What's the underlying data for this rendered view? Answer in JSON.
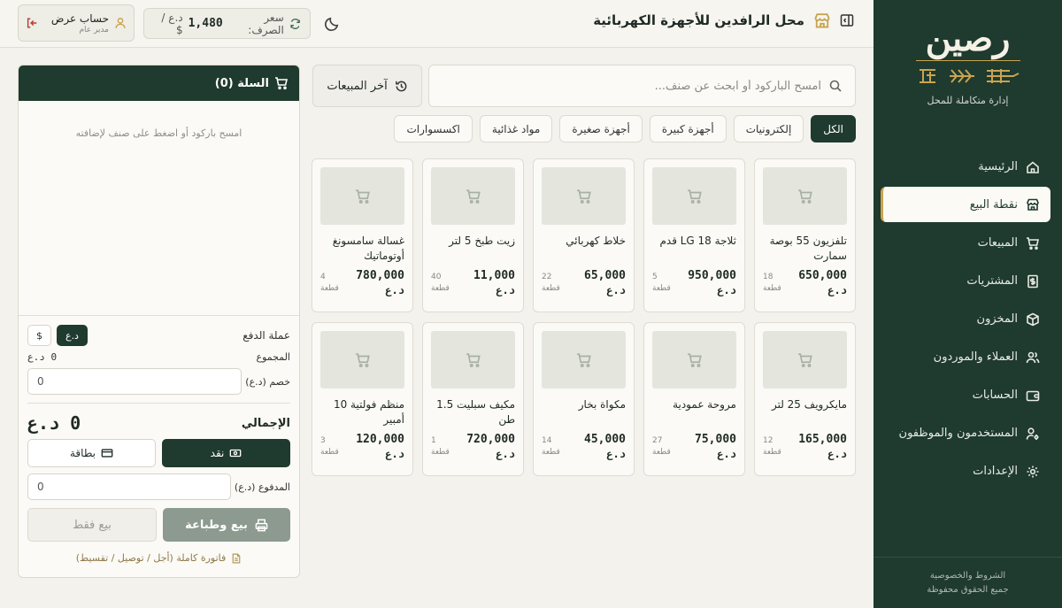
{
  "sidebar": {
    "logo_text": "رصين",
    "tagline": "إدارة متكاملة للمحل",
    "items": [
      {
        "label": "الرئيسية",
        "icon": "home-icon"
      },
      {
        "label": "نقطة البيع",
        "icon": "store-icon"
      },
      {
        "label": "المبيعات",
        "icon": "cart-icon"
      },
      {
        "label": "المشتريات",
        "icon": "receipt-icon"
      },
      {
        "label": "المخزون",
        "icon": "box-icon"
      },
      {
        "label": "العملاء والموردون",
        "icon": "users-icon"
      },
      {
        "label": "الحسابات",
        "icon": "wallet-icon"
      },
      {
        "label": "المستخدمون والموظفون",
        "icon": "user-cog-icon"
      },
      {
        "label": "الإعدادات",
        "icon": "gear-icon"
      }
    ],
    "active_index": 1,
    "footer_terms": "الشروط والخصوصية",
    "footer_rights": "جميع الحقوق محفوظة"
  },
  "header": {
    "store_name": "محل الرافدين للأجهزة الكهربائية",
    "rate_label": "سعر الصرف:",
    "rate_value": "1,480",
    "rate_unit": "د.ع / $",
    "account_name": "حساب عرض",
    "account_role": "مدير عام"
  },
  "search": {
    "placeholder": "امسح الباركود أو ابحث عن صنف...",
    "recent_label": "آخر المبيعات"
  },
  "categories": [
    "الكل",
    "إلكترونيات",
    "أجهزة كبيرة",
    "أجهزة صغيرة",
    "مواد غذائية",
    "اكسسوارات"
  ],
  "active_category": 0,
  "currency_suffix": "د.ع",
  "stock_unit": "قطعة",
  "products": [
    {
      "name": "تلفزيون 55 بوصة سمارت",
      "price": "650,000",
      "stock": "18"
    },
    {
      "name": "ثلاجة LG 18 قدم",
      "price": "950,000",
      "stock": "5"
    },
    {
      "name": "خلاط كهربائي",
      "price": "65,000",
      "stock": "22"
    },
    {
      "name": "زيت طبخ 5 لتر",
      "price": "11,000",
      "stock": "40"
    },
    {
      "name": "غسالة سامسونغ أوتوماتيك",
      "price": "780,000",
      "stock": "4"
    },
    {
      "name": "مايكرويف 25 لتر",
      "price": "165,000",
      "stock": "12"
    },
    {
      "name": "مروحة عمودية",
      "price": "75,000",
      "stock": "27"
    },
    {
      "name": "مكواة بخار",
      "price": "45,000",
      "stock": "14"
    },
    {
      "name": "مكيف سبليت 1.5 طن",
      "price": "720,000",
      "stock": "1"
    },
    {
      "name": "منظم فولتية 10 أمبير",
      "price": "120,000",
      "stock": "3"
    }
  ],
  "cart": {
    "title": "السلة (0)",
    "empty_text": "امسح باركود أو اضغط على صنف لإضافته",
    "pay_currency_label": "عملة الدفع",
    "currency_iqd": "د.ع",
    "currency_usd": "$",
    "subtotal_label": "المجموع",
    "subtotal_value": "0 د.ع",
    "discount_label": "خصم (د.ع)",
    "discount_value": "0",
    "total_label": "الإجمالي",
    "total_value": "0 د.ع",
    "cash_label": "نقد",
    "card_label": "بطاقة",
    "paid_label": "المدفوع (د.ع)",
    "paid_value": "0",
    "sell_print_label": "بيع وطباعة",
    "sell_only_label": "بيع فقط",
    "full_invoice_label": "فاتورة كاملة (أجل / توصيل / تقسيط)"
  },
  "colors": {
    "sidebar_bg": "#1f3a2e",
    "accent_gold": "#c9a450",
    "page_bg": "#f3f2ec"
  }
}
